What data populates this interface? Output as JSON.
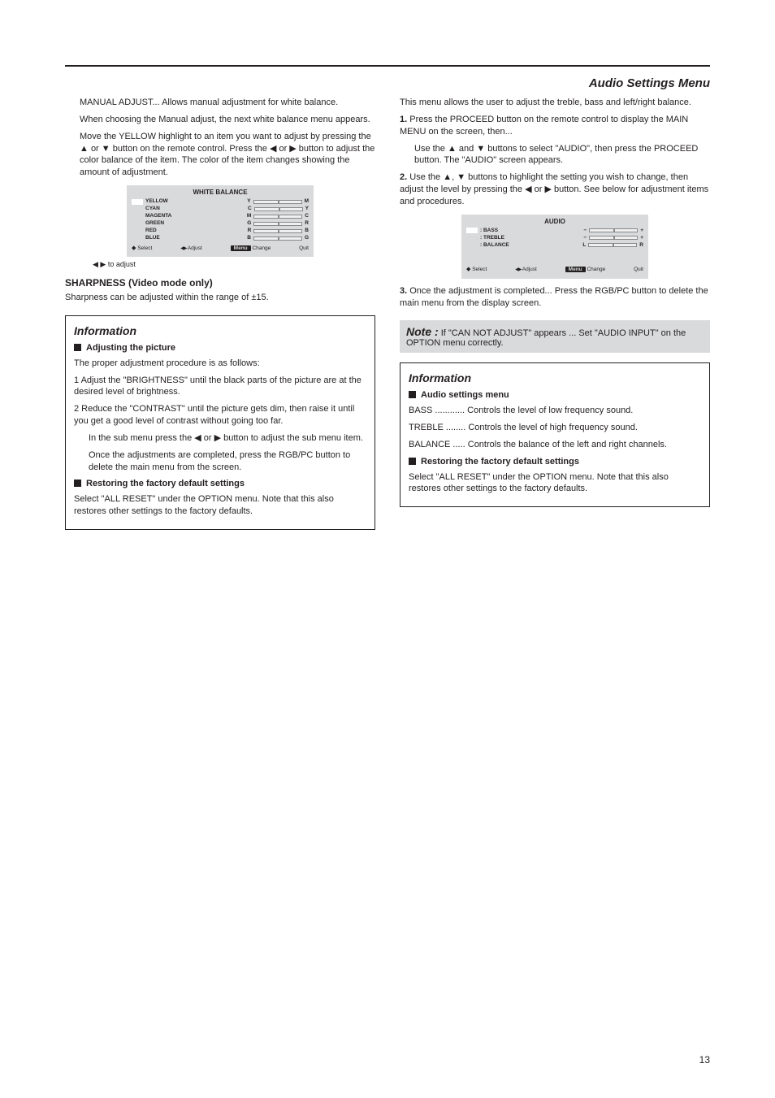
{
  "header": {
    "section_title": "Audio Settings Menu"
  },
  "left": {
    "para1": "MANUAL ADJUST... Allows manual adjustment for white balance.",
    "para2a": "When choosing the Manual adjust, the next white balance menu appears.",
    "para2b": "Move the YELLOW highlight to an item you want to adjust by pressing the ▲ or ▼ button on the remote control.  Press the ◀ or ▶ button to adjust the color balance of the item.  The color of the item changes showing the amount of adjustment.",
    "osd1": {
      "title": "WHITE BALANCE",
      "rows": [
        {
          "leftL": "Y",
          "leftLabel": "YELLOW",
          "rightR": "M"
        },
        {
          "leftL": "C",
          "leftLabel": "CYAN",
          "rightR": "Y"
        },
        {
          "leftL": "M",
          "leftLabel": "MAGENTA",
          "rightR": "C"
        },
        {
          "leftL": "G",
          "leftLabel": "GREEN",
          "rightR": "R"
        },
        {
          "leftL": "R",
          "leftLabel": "RED",
          "rightR": "B"
        },
        {
          "leftL": "B",
          "leftLabel": "BLUE",
          "rightR": "G"
        }
      ],
      "swatch": "",
      "nav": {
        "select": "Select",
        "adjust": "Adjust",
        "change": "Change",
        "quit": "Quit",
        "menu": "Menu"
      }
    },
    "osd1_caption": "◀  ▶ to adjust",
    "h3a": "SHARPNESS (Video mode only)",
    "para3": "Sharpness can be adjusted within the range of  ±15.",
    "info1": {
      "title": "Information",
      "b1_title": "Adjusting the picture",
      "b1_line1": "The proper adjustment procedure is as follows:",
      "b1_line2": "1 Adjust the \"BRIGHTNESS\" until the black parts of the picture are at the desired level of brightness.",
      "b1_line3": "2 Reduce the \"CONTRAST\" until the picture gets dim, then raise it until you get a good level of contrast without going too far.",
      "b1_line4a": "In the sub menu press the ◀ or ▶ button to adjust the sub menu item.",
      "b1_line4b": "Once the adjustments are completed, press the RGB/PC button to delete the main menu from the screen.",
      "b2_title": "Restoring the factory default settings",
      "b2_body": "Select \"ALL RESET\" under the OPTION menu.  Note that this also restores other settings to the factory defaults."
    }
  },
  "right": {
    "para1": "This menu allows the user to adjust the treble, bass and left/right balance.",
    "step1_num": "1.",
    "step1a": "Press the PROCEED button on the remote control to display the MAIN MENU on the screen, then...",
    "step1b": "Use the ▲ and ▼ buttons to select \"AUDIO\", then press the PROCEED button.  The \"AUDIO\" screen appears.",
    "step2_num": "2.",
    "step2": "Use the ▲, ▼ buttons to highlight the setting you wish to change, then adjust the level by pressing the  ◀ or ▶ button.  See below for adjustment items and procedures.",
    "osd2": {
      "title": "AUDIO",
      "rows": [
        {
          "label": ":  BASS",
          "iL": "−",
          "iR": "+"
        },
        {
          "label": ":  TREBLE",
          "iL": "−",
          "iR": "+"
        },
        {
          "label": ":  BALANCE",
          "iL": "L",
          "iR": "R"
        }
      ],
      "swatch": "",
      "nav": {
        "select": "Select",
        "adjust": "Adjust",
        "change": "Change",
        "quit": "Quit",
        "menu": "Menu"
      }
    },
    "step3_num": "3.",
    "step3": "Once the adjustment is completed...  Press the RGB/PC button to delete the main menu from the display screen.",
    "note": {
      "title": "Note :",
      "body": "If \"CAN NOT ADJUST\" appears ... Set \"AUDIO INPUT\" on the OPTION menu correctly."
    },
    "info2": {
      "title": "Information",
      "b1_title": "Audio settings menu",
      "b1_bass": "BASS ............  Controls the level of low frequency sound.",
      "b1_treble": "TREBLE ........  Controls the level of high frequency sound.",
      "b1_balance": "BALANCE .....  Controls the balance of the left and right channels.",
      "b2_title": "Restoring the factory default settings",
      "b2_body": "Select \"ALL RESET\" under the OPTION menu. Note that this also restores other settings to the factory defaults."
    }
  },
  "page_number": "13"
}
